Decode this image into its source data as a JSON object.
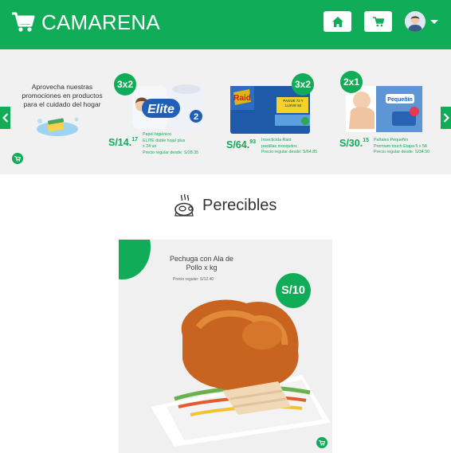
{
  "header": {
    "brand": "CAMARENA",
    "icons": [
      "cart-icon",
      "home-icon",
      "cart-icon",
      "avatar-icon",
      "caret-down-icon"
    ]
  },
  "carousel": {
    "promo_text": "Aprovecha nuestras promociones en productos para el cuidado del hogar",
    "items": [
      {
        "badge": "3x2",
        "price": "S/14.",
        "price_cents": "17",
        "desc": [
          "Papel higiénico",
          "ELITE doble hoja/ plus",
          "x 24 un",
          "Precio regular desde: S/28.35"
        ]
      },
      {
        "badge": "3x2",
        "price": "S/64.",
        "price_cents": "93",
        "desc": [
          "Insecticida Raid",
          "pastillas mosquitos",
          "Precio regular desde: S/64.85"
        ]
      },
      {
        "badge": "2x1",
        "price": "S/30.",
        "price_cents": "15",
        "desc": [
          "Pañales Pequeñín",
          "Premium touch Etapa 5 x 58",
          "Precio regular desde: S/34.50"
        ]
      }
    ],
    "raid_banner": "PAGUE 72 Y LLEVE 84"
  },
  "section": {
    "title": "Perecibles"
  },
  "product": {
    "name": "Pechuga con Ala de Pollo x kg",
    "regular_price": "Precio regular: S/12.40",
    "price": "S/10"
  },
  "colors": {
    "brand_green": "#10ac57",
    "carousel_bg": "#f1f1f1"
  }
}
